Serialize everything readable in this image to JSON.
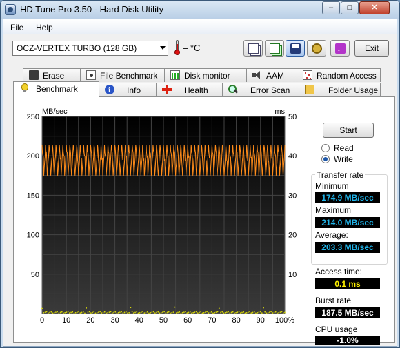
{
  "window": {
    "title": "HD Tune Pro 3.50 - Hard Disk Utility",
    "min_glyph": "–",
    "max_glyph": "□",
    "close_glyph": "✕"
  },
  "menu": {
    "file": "File",
    "help": "Help"
  },
  "toolbar": {
    "drive": "OCZ-VERTEX TURBO (128 GB)",
    "temperature": "– °C",
    "exit_label": "Exit"
  },
  "tabs_top": [
    {
      "label": "Erase",
      "icon": "trash-icon"
    },
    {
      "label": "File Benchmark",
      "icon": "file-benchmark-icon"
    },
    {
      "label": "Disk monitor",
      "icon": "disk-monitor-icon"
    },
    {
      "label": "AAM",
      "icon": "speaker-icon"
    },
    {
      "label": "Random Access",
      "icon": "random-access-icon"
    }
  ],
  "tabs_bottom": [
    {
      "label": "Benchmark",
      "icon": "lightbulb-icon",
      "active": true
    },
    {
      "label": "Info",
      "icon": "info-icon"
    },
    {
      "label": "Health",
      "icon": "health-cross-icon"
    },
    {
      "label": "Error Scan",
      "icon": "magnifier-icon"
    },
    {
      "label": "Folder Usage",
      "icon": "folder-icon"
    }
  ],
  "benchmark": {
    "start_label": "Start",
    "read_label": "Read",
    "write_label": "Write",
    "mode": "Write",
    "transfer_rate_title": "Transfer rate",
    "minimum_label": "Minimum",
    "minimum_value": "174.9 MB/sec",
    "maximum_label": "Maximum",
    "maximum_value": "214.0 MB/sec",
    "average_label": "Average:",
    "average_value": "203.3 MB/sec",
    "access_time_label": "Access time:",
    "access_time_value": "0.1 ms",
    "burst_rate_label": "Burst rate",
    "burst_rate_value": "187.5 MB/sec",
    "cpu_usage_label": "CPU usage",
    "cpu_usage_value": "-1.0%"
  },
  "chart_data": {
    "type": "line",
    "ylabel_left": "MB/sec",
    "ylabel_right": "ms",
    "ylim_left": [
      0,
      250
    ],
    "ylim_right": [
      0,
      50
    ],
    "xlim": [
      0,
      100
    ],
    "left_ticks": [
      "250",
      "200",
      "150",
      "100",
      "50"
    ],
    "right_ticks": [
      "50",
      "40",
      "30",
      "20",
      "10"
    ],
    "x_ticks": [
      "0",
      "10",
      "20",
      "30",
      "40",
      "50",
      "60",
      "70",
      "80",
      "90",
      "100%"
    ],
    "grid": true,
    "series": [
      {
        "name": "",
        "axis": "left",
        "color": "#ff8c1a",
        "min": 174.9,
        "max": 214.0,
        "avg": 203.3
      },
      {
        "name": "",
        "axis": "right",
        "color": "#d6d60a",
        "approx_value": 0.1
      }
    ]
  }
}
